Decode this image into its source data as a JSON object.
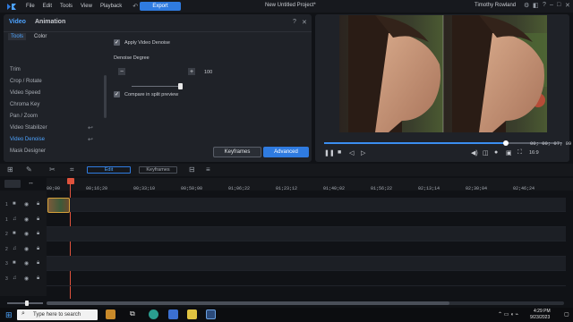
{
  "titlebar": {
    "menus": [
      "File",
      "Edit",
      "Tools",
      "View",
      "Playback"
    ],
    "export_label": "Export",
    "project_title": "New Untitled Project*",
    "user_name": "Timothy Rowland"
  },
  "panel": {
    "tabs": [
      "Video",
      "Animation"
    ],
    "subtabs": [
      "Tools",
      "Color"
    ],
    "help": "?",
    "close": "✕",
    "tools": [
      {
        "label": "Trim"
      },
      {
        "label": "Crop / Rotate"
      },
      {
        "label": "Video Speed"
      },
      {
        "label": "Chroma Key"
      },
      {
        "label": "Pan / Zoom"
      },
      {
        "label": "Video Stabilizer",
        "undo": true
      },
      {
        "label": "Video Denoise",
        "undo": true,
        "active": true
      },
      {
        "label": "Mask Designer"
      }
    ],
    "apply_denoise_label": "Apply Video Denoise",
    "apply_denoise_checked": true,
    "degree_label": "Denoise Degree",
    "degree_value": "100",
    "degree_fraction": 0.95,
    "minus": "−",
    "plus": "+",
    "split_preview_label": "Compare in split preview",
    "split_preview_checked": true,
    "keyframes_label": "Keyframes",
    "advanced_label": "Advanced"
  },
  "preview": {
    "timecode": "00; 00; 07; 09",
    "progress_fraction": 0.76,
    "aspect": "16:9"
  },
  "timeline": {
    "edit_tab": "Edit",
    "keyframes_tab": "Keyframes",
    "ticks": [
      "00;00",
      "00;16;20",
      "00;33;10",
      "00;50;00",
      "01;06;22",
      "01;23;12",
      "01;40;02",
      "01;56;22",
      "02;13;14",
      "02;30;04",
      "02;46;24"
    ],
    "tracks": [
      "1",
      "1",
      "2",
      "2",
      "3",
      "3"
    ]
  },
  "taskbar": {
    "search_placeholder": "Type here to search",
    "time": "4:29 PM",
    "date": "9/23/2023"
  },
  "colors": {
    "accent": "#2f7be0",
    "active_tool": "#4da3ff",
    "playhead": "#e0533d",
    "clip_border": "#d6a13a"
  }
}
